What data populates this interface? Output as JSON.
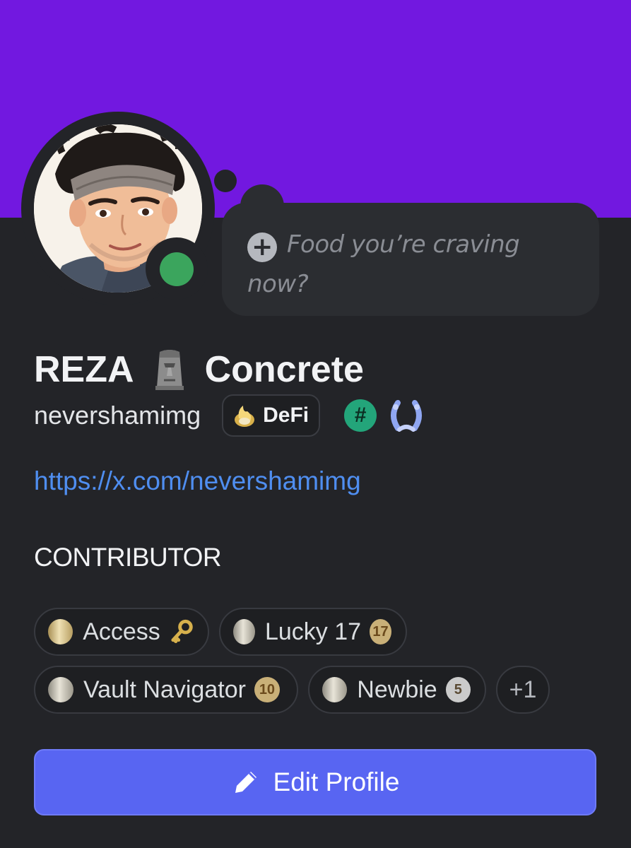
{
  "profile": {
    "display_name_part1": "REZA",
    "display_name_part2": "Concrete",
    "username": "nevershamimg",
    "link": "https://x.com/nevershamimg",
    "role": "CONTRIBUTOR",
    "status": "online",
    "status_color": "#3ba55d",
    "banner_color": "#7218e0"
  },
  "custom_status": {
    "line1": "Food you’re craving",
    "line2": "now?"
  },
  "server_tag": {
    "label": "DeFi"
  },
  "badges": [
    {
      "label": "Access",
      "extra": "key-icon"
    },
    {
      "label": "Lucky 17",
      "count": "17"
    },
    {
      "label": "Vault Navigator",
      "count": "10"
    },
    {
      "label": "Newbie",
      "count": "5"
    }
  ],
  "badges_more": "+1",
  "hash_badge": "#",
  "edit_button": {
    "label": "Edit Profile",
    "color": "#5865f2"
  }
}
